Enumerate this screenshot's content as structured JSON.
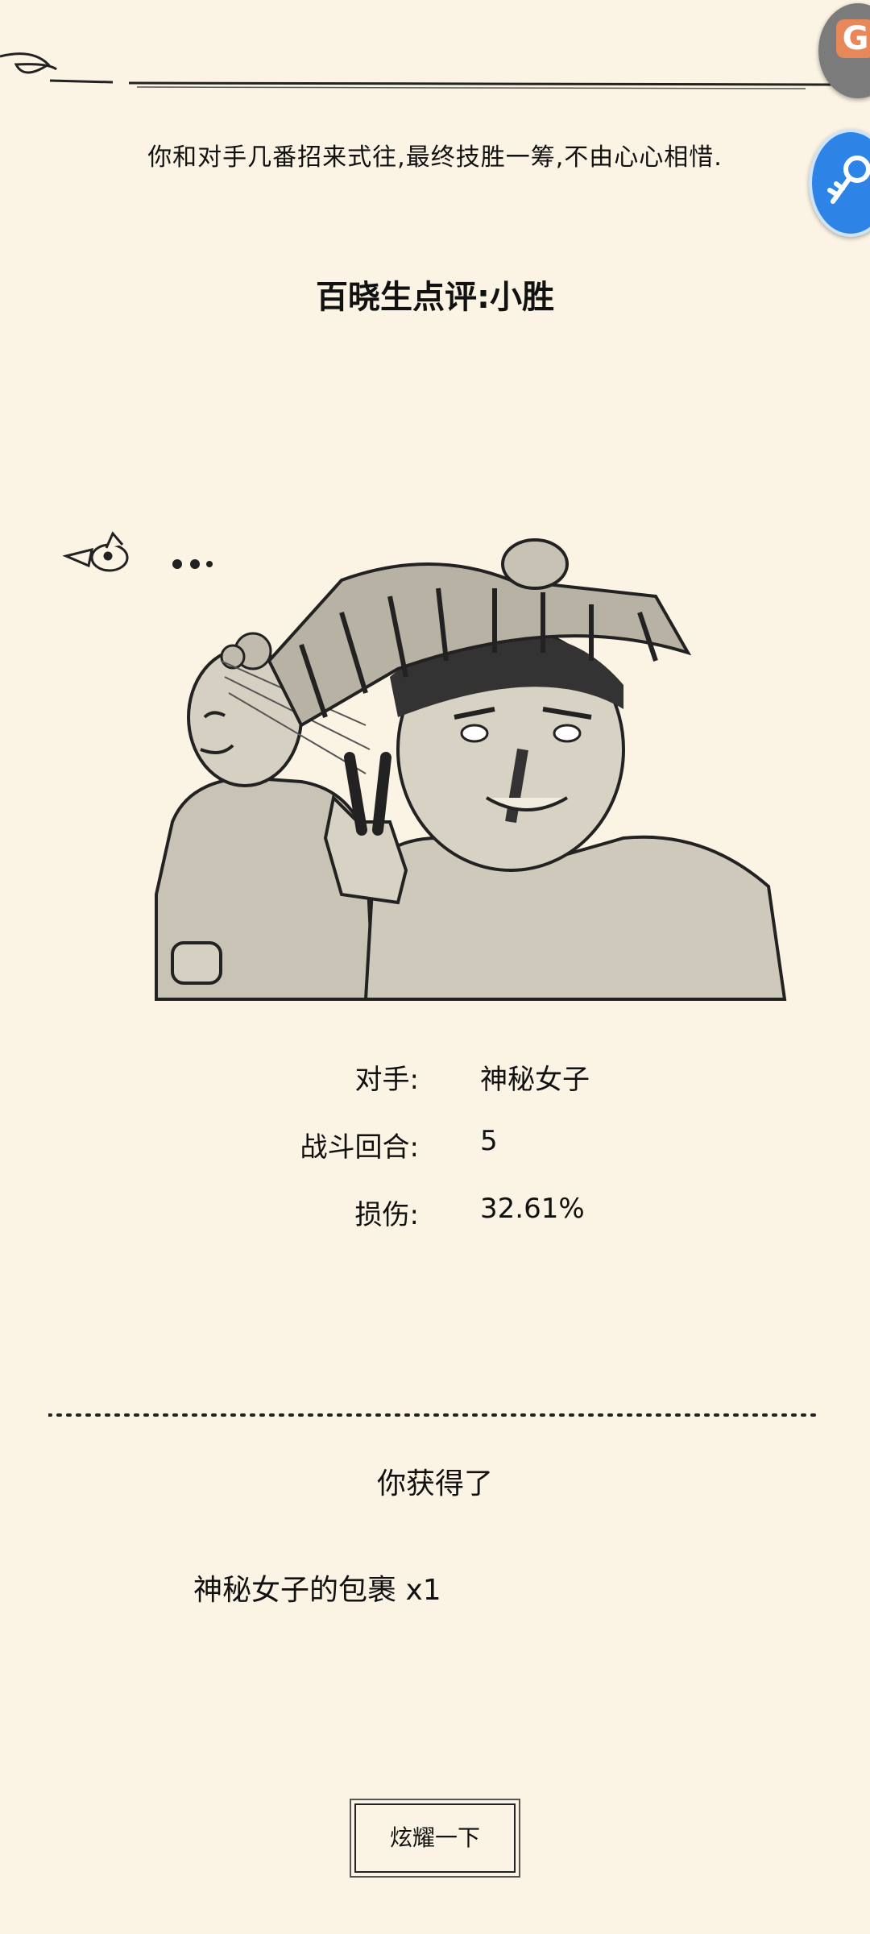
{
  "story_text": "你和对手几番招来式往,最终技胜一筹,不由心心相惜.",
  "rating": "百晓生点评:小胜",
  "stats": [
    {
      "label": "对手:",
      "value": "神秘女子"
    },
    {
      "label": "战斗回合:",
      "value": "5"
    },
    {
      "label": "损伤:",
      "value": "32.61%"
    }
  ],
  "reward_title": "你获得了",
  "reward_item": "神秘女子的包裹 x1",
  "share_button": "炫耀一下",
  "floating_buttons": {
    "top_icon": "game-launcher-icon",
    "top_icon_glyph": "G",
    "key_icon": "key-icon"
  },
  "colors": {
    "background": "#fbf3e3",
    "key_button": "#2e84e6",
    "top_button": "#7b7b7b",
    "top_button_accent": "#e8875a"
  }
}
